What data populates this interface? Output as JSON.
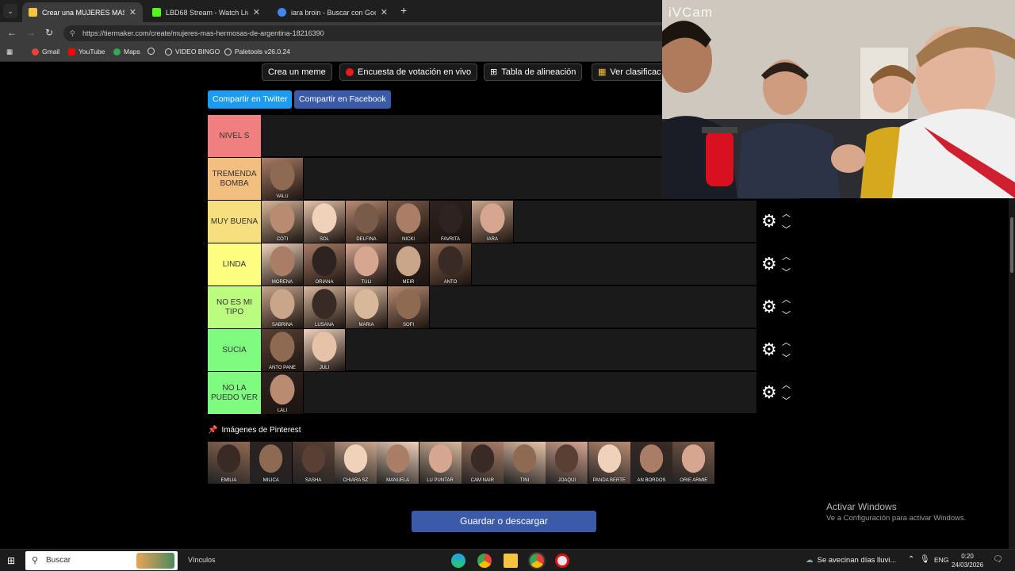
{
  "browser": {
    "tabs": [
      {
        "title": "Crear una MUJERES MAS HERM",
        "active": true,
        "favicon_color": "#f5c542"
      },
      {
        "title": "LBD68 Stream - Watch Live on",
        "active": false,
        "favicon_color": "#53fc18"
      },
      {
        "title": "iara broin - Buscar con Google",
        "active": false,
        "favicon_color": "#4285f4"
      }
    ],
    "close_glyph": "✕",
    "new_tab_glyph": "+",
    "url": "https://tiermaker.com/create/mujeres-mas-hermosas-de-argentina-18216390",
    "bookmarks": [
      {
        "label": "",
        "icon": "apps-icon"
      },
      {
        "label": "Gmail",
        "icon": "gmail-icon",
        "color": "#ea4335"
      },
      {
        "label": "YouTube",
        "icon": "youtube-icon",
        "color": "#ff0000"
      },
      {
        "label": "Maps",
        "icon": "maps-icon",
        "color": "#34a853"
      },
      {
        "label": "",
        "icon": "web-icon",
        "color": "#ddd"
      },
      {
        "label": "VIDEO BINGO",
        "icon": "web-icon",
        "color": "#ddd"
      },
      {
        "label": "Paletools v26.0.24",
        "icon": "web-icon",
        "color": "#ddd"
      }
    ]
  },
  "page": {
    "top_buttons": [
      "Crea un meme",
      "Encuesta de votación en vivo",
      "Tabla de alineación",
      "Ver clasificac"
    ],
    "share": {
      "twitter": "Compartir en Twitter",
      "facebook": "Compartir en Facebook"
    },
    "tiers": [
      {
        "label": "NIVEL S",
        "color": "#f07f7f",
        "items": []
      },
      {
        "label": "TREMENDA BOMBA",
        "color": "#f3bf81",
        "items": [
          "VALU"
        ]
      },
      {
        "label": "MUY BUENA",
        "color": "#f7df80",
        "items": [
          "COTI",
          "SOL",
          "DELFINA",
          "NICKI",
          "FAVRITA",
          "IARA"
        ]
      },
      {
        "label": "LINDA",
        "color": "#fdfd7f",
        "items": [
          "MORENA",
          "ORIANA",
          "TULI",
          "MEIR",
          "ANTO"
        ]
      },
      {
        "label": "NO ES MI TIPO",
        "color": "#bbfb7f",
        "items": [
          "SABRINA",
          "LUSANA",
          "MARIA",
          "SOFI"
        ]
      },
      {
        "label": "SUCIA",
        "color": "#7ffb7f",
        "items": [
          "ANTO PANE",
          "JULI"
        ]
      },
      {
        "label": "NO LA PUEDO VER",
        "color": "#7ffb7f",
        "items": [
          "LALI"
        ]
      }
    ],
    "gear_glyph": "⚙",
    "up_glyph": "︿",
    "down_glyph": "﹀",
    "pinterest_title": "Imágenes de Pinterest",
    "pinterest_items": [
      "EMILIA",
      "MILICA",
      "SASHA",
      "CHIARA SZ",
      "MANUELA",
      "LU PUNTAR",
      "CAM NAIR",
      "TINI",
      "JOAQUI",
      "PANDA BERTE",
      "AN BORDOS",
      "ORIE ARMIE"
    ],
    "save_button": "Guardar o descargar",
    "activate_windows": {
      "title": "Activar Windows",
      "subtitle": "Ve a Configuración para activar Windows."
    }
  },
  "cam": {
    "title": "iVCam"
  },
  "taskbar": {
    "search_placeholder": "Buscar",
    "vinculos": "Vínculos",
    "news": "Se avecinan días lluvi...",
    "lang": "ENG",
    "time": "0:20",
    "date": "24/03/2026"
  }
}
